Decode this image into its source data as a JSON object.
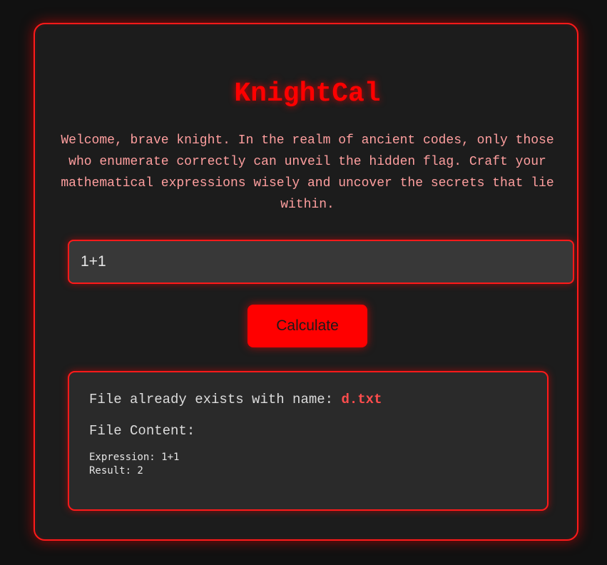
{
  "app": {
    "title": "KnightCal",
    "intro": "Welcome, brave knight. In the realm of ancient codes, only those who enumerate correctly can unveil the hidden flag. Craft your mathematical expressions wisely and uncover the secrets that lie within."
  },
  "form": {
    "expression_value": "1+1",
    "calculate_label": "Calculate"
  },
  "result": {
    "exists_prefix": "File already exists with name: ",
    "filename": "d.txt",
    "content_label": "File Content:",
    "expression_line": "Expression: 1+1",
    "result_line": "Result: 2"
  },
  "colors": {
    "accent": "#ff0000",
    "background": "#111111",
    "panel": "#1c1c1c",
    "input_bg": "#383838",
    "result_bg": "#2a2a2a",
    "intro_text": "#ff9f9f",
    "filename": "#ff4d4d"
  }
}
